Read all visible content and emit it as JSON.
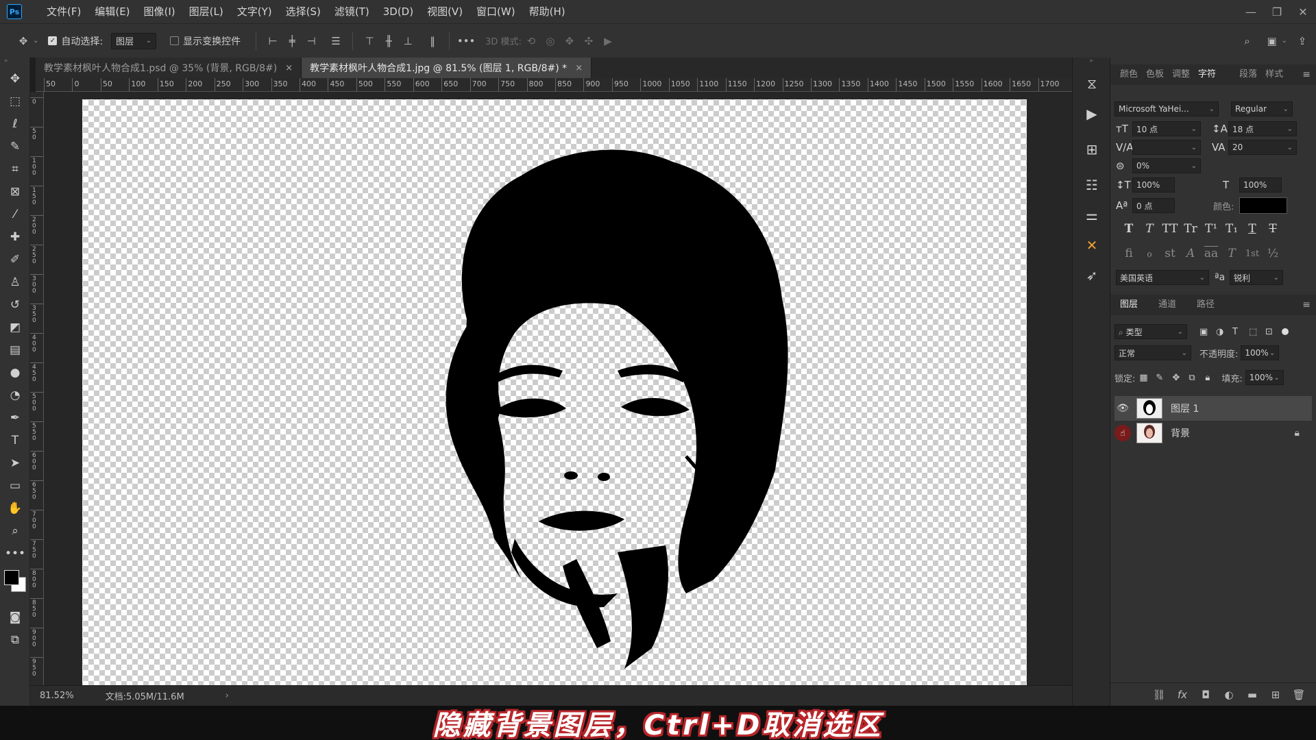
{
  "app": {
    "logo": "Ps"
  },
  "menu": [
    "文件(F)",
    "编辑(E)",
    "图像(I)",
    "图层(L)",
    "文字(Y)",
    "选择(S)",
    "滤镜(T)",
    "3D(D)",
    "视图(V)",
    "窗口(W)",
    "帮助(H)"
  ],
  "options": {
    "auto_select_label": "自动选择:",
    "auto_select_value": "图层",
    "show_transform_label": "显示变换控件",
    "mode_3d_label": "3D 模式:"
  },
  "tabs": [
    {
      "label": "教学素材枫叶人物合成1.psd @ 35% (背景, RGB/8#)",
      "close": "×"
    },
    {
      "label": "教学素材枫叶人物合成1.jpg @ 81.5% (图层 1, RGB/8#) *",
      "close": "×"
    }
  ],
  "ruler_top": [
    "50",
    "0",
    "50",
    "100",
    "150",
    "200",
    "250",
    "300",
    "350",
    "400",
    "450",
    "500",
    "550",
    "600",
    "650",
    "700",
    "750",
    "800",
    "850",
    "900",
    "950",
    "1000",
    "1050",
    "1100",
    "1150",
    "1200",
    "1250",
    "1300",
    "1350",
    "1400",
    "1450",
    "1500",
    "1550",
    "1600",
    "1650",
    "1700"
  ],
  "ruler_left": [
    "0",
    "5 0",
    "1 0 0",
    "1 5 0",
    "2 0 0",
    "2 5 0",
    "3 0 0",
    "3 5 0",
    "4 0 0",
    "4 5 0",
    "5 0 0",
    "5 5 0",
    "6 0 0",
    "6 5 0",
    "7 0 0",
    "7 5 0",
    "8 0 0",
    "8 5 0",
    "9 0 0",
    "9 5 0"
  ],
  "status": {
    "zoom": "81.52%",
    "doc": "文档:5.05M/11.6M",
    "arrow": "›"
  },
  "subtitle": "隐藏背景图层，Ctrl+D取消选区",
  "character_panel": {
    "tabs": [
      "颜色",
      "色板",
      "调整",
      "字符",
      "段落",
      "样式"
    ],
    "active_tab": "字符",
    "font_family": "Microsoft YaHei...",
    "font_style": "Regular",
    "font_size": "10 点",
    "leading": "18 点",
    "kerning": "",
    "tracking": "20",
    "scale_pct": "0%",
    "vertical_scale": "100%",
    "horizontal_scale": "100%",
    "baseline_shift": "0 点",
    "color_label": "颜色:",
    "color_value": "#000000",
    "format_buttons": [
      "T",
      "T",
      "TT",
      "Tr",
      "T¹",
      "T₁",
      "T",
      "T"
    ],
    "opentype_buttons": [
      "fi",
      "ℴ",
      "st",
      "A",
      "aa",
      "T",
      "1st",
      "½"
    ],
    "language": "美国英语",
    "aa_label": "ªa",
    "antialias": "锐利"
  },
  "layers_panel": {
    "tabs": [
      "图层",
      "通道",
      "路径"
    ],
    "active_tab": "图层",
    "filter_kind": "类型",
    "blend_mode": "正常",
    "opacity_label": "不透明度:",
    "opacity": "100%",
    "lock_label": "锁定:",
    "fill_label": "填充:",
    "fill": "100%",
    "layers": [
      {
        "name": "图层 1",
        "visible": true,
        "selected": true
      },
      {
        "name": "背景",
        "visible": false,
        "selected": false,
        "locked": true
      }
    ]
  }
}
